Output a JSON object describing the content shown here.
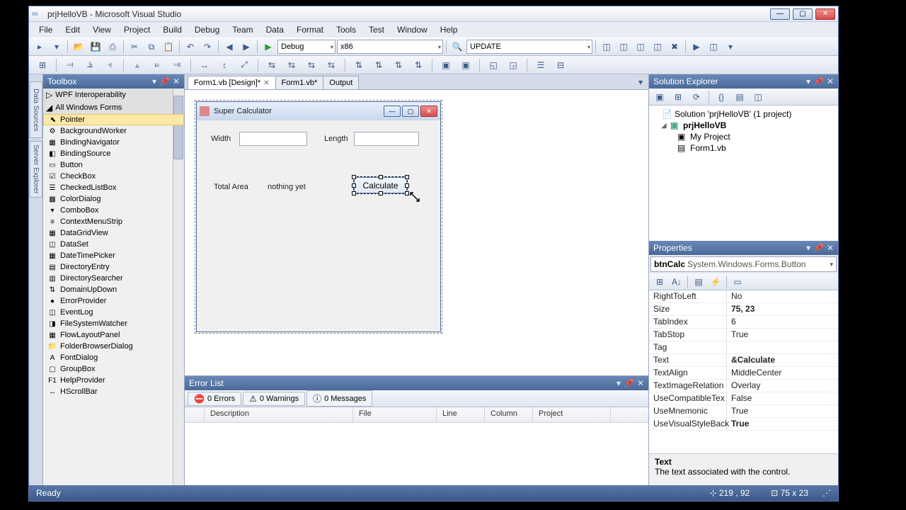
{
  "title": "prjHelloVB - Microsoft Visual Studio",
  "menu": [
    "File",
    "Edit",
    "View",
    "Project",
    "Build",
    "Debug",
    "Team",
    "Data",
    "Format",
    "Tools",
    "Test",
    "Window",
    "Help"
  ],
  "toolbar": {
    "config": "Debug",
    "platform": "x86",
    "update": "UPDATE"
  },
  "leftRail": [
    "Data Sources",
    "Server Explorer"
  ],
  "toolbox": {
    "title": "Toolbox",
    "groups": [
      {
        "label": "WPF Interoperability",
        "expanded": false
      },
      {
        "label": "All Windows Forms",
        "expanded": true
      }
    ],
    "items": [
      {
        "label": "Pointer",
        "icon": "⬉",
        "selected": true
      },
      {
        "label": "BackgroundWorker",
        "icon": "⚙"
      },
      {
        "label": "BindingNavigator",
        "icon": "▦"
      },
      {
        "label": "BindingSource",
        "icon": "◧"
      },
      {
        "label": "Button",
        "icon": "▭"
      },
      {
        "label": "CheckBox",
        "icon": "☑"
      },
      {
        "label": "CheckedListBox",
        "icon": "☰"
      },
      {
        "label": "ColorDialog",
        "icon": "▩"
      },
      {
        "label": "ComboBox",
        "icon": "▾"
      },
      {
        "label": "ContextMenuStrip",
        "icon": "≡"
      },
      {
        "label": "DataGridView",
        "icon": "▦"
      },
      {
        "label": "DataSet",
        "icon": "◫"
      },
      {
        "label": "DateTimePicker",
        "icon": "▦"
      },
      {
        "label": "DirectoryEntry",
        "icon": "▤"
      },
      {
        "label": "DirectorySearcher",
        "icon": "▥"
      },
      {
        "label": "DomainUpDown",
        "icon": "⇅"
      },
      {
        "label": "ErrorProvider",
        "icon": "●"
      },
      {
        "label": "EventLog",
        "icon": "◫"
      },
      {
        "label": "FileSystemWatcher",
        "icon": "◨"
      },
      {
        "label": "FlowLayoutPanel",
        "icon": "▦"
      },
      {
        "label": "FolderBrowserDialog",
        "icon": "📁"
      },
      {
        "label": "FontDialog",
        "icon": "A"
      },
      {
        "label": "GroupBox",
        "icon": "▢"
      },
      {
        "label": "HelpProvider",
        "icon": "F1"
      },
      {
        "label": "HScrollBar",
        "icon": "↔"
      }
    ]
  },
  "tabs": [
    {
      "label": "Form1.vb [Design]*",
      "active": true,
      "closable": true
    },
    {
      "label": "Form1.vb*",
      "active": false,
      "closable": false
    },
    {
      "label": "Output",
      "active": false,
      "closable": false
    }
  ],
  "form": {
    "title": "Super Calculator",
    "widthLabel": "Width",
    "lengthLabel": "Length",
    "totalAreaLabel": "Total Area",
    "resultText": "nothing yet",
    "calcLabel": "Calculate"
  },
  "errorList": {
    "title": "Error List",
    "tabs": [
      {
        "icon": "⛔",
        "label": "0 Errors"
      },
      {
        "icon": "⚠",
        "label": "0 Warnings"
      },
      {
        "icon": "ⓘ",
        "label": "0 Messages"
      }
    ],
    "cols": [
      "",
      "Description",
      "File",
      "Line",
      "Column",
      "Project"
    ]
  },
  "solution": {
    "title": "Solution Explorer",
    "root": "Solution 'prjHelloVB' (1 project)",
    "project": "prjHelloVB",
    "items": [
      "My Project",
      "Form1.vb"
    ]
  },
  "properties": {
    "title": "Properties",
    "selName": "btnCalc",
    "selType": "System.Windows.Forms.Button",
    "rows": [
      {
        "name": "RightToLeft",
        "val": "No"
      },
      {
        "name": "Size",
        "val": "75, 23",
        "bold": true
      },
      {
        "name": "TabIndex",
        "val": "6"
      },
      {
        "name": "TabStop",
        "val": "True"
      },
      {
        "name": "Tag",
        "val": ""
      },
      {
        "name": "Text",
        "val": "&Calculate",
        "bold": true
      },
      {
        "name": "TextAlign",
        "val": "MiddleCenter"
      },
      {
        "name": "TextImageRelation",
        "val": "Overlay"
      },
      {
        "name": "UseCompatibleTex",
        "val": "False"
      },
      {
        "name": "UseMnemonic",
        "val": "True"
      },
      {
        "name": "UseVisualStyleBack",
        "val": "True",
        "bold": true
      }
    ],
    "descName": "Text",
    "descText": "The text associated with the control."
  },
  "status": {
    "ready": "Ready",
    "pos": "219 , 92",
    "size": "75 x 23"
  }
}
